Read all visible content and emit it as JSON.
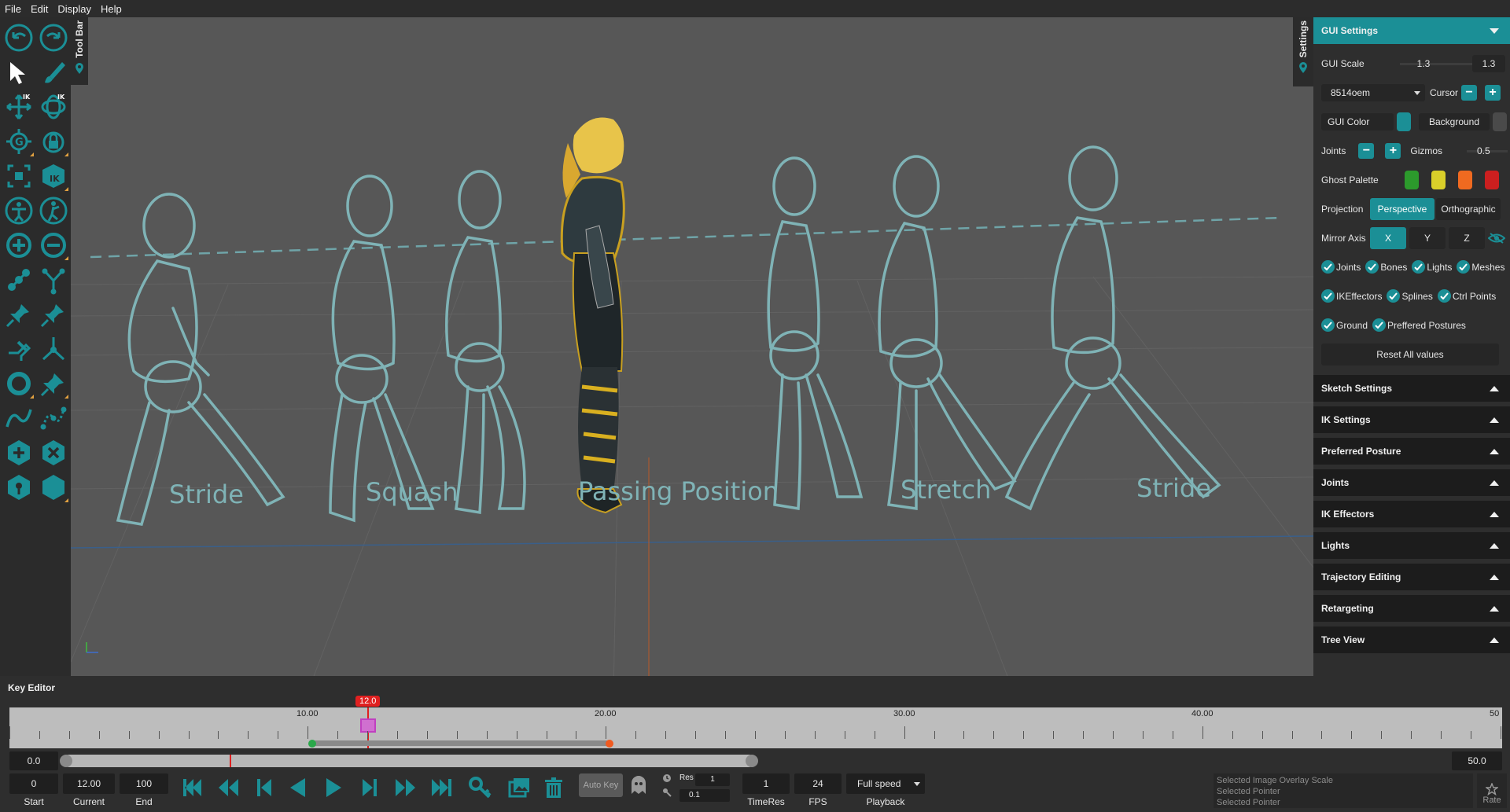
{
  "menubar": {
    "items": [
      "File",
      "Edit",
      "Display",
      "Help"
    ]
  },
  "toolbar": {
    "title": "Tool Bar",
    "tools": [
      {
        "name": "undo-icon"
      },
      {
        "name": "redo-icon"
      },
      {
        "name": "select-arrow-icon"
      },
      {
        "name": "brush-icon"
      },
      {
        "name": "ik-move-icon",
        "badge": "IK"
      },
      {
        "name": "ik-rotate-icon",
        "badge": "IK"
      },
      {
        "name": "global-icon",
        "badge": "G"
      },
      {
        "name": "lock-icon"
      },
      {
        "name": "frame-icon"
      },
      {
        "name": "ik-cube-icon",
        "badge": "IK"
      },
      {
        "name": "body-icon"
      },
      {
        "name": "pose-icon"
      },
      {
        "name": "add-joint-icon"
      },
      {
        "name": "remove-joint-icon"
      },
      {
        "name": "joint-chain-icon"
      },
      {
        "name": "fork-icon"
      },
      {
        "name": "pin-icon"
      },
      {
        "name": "pin-add-icon"
      },
      {
        "name": "pin-down-icon"
      },
      {
        "name": "branch-icon"
      },
      {
        "name": "ring-icon"
      },
      {
        "name": "pin-tilt-icon"
      },
      {
        "name": "spline-icon"
      },
      {
        "name": "spline-points-icon"
      },
      {
        "name": "hex-add-icon"
      },
      {
        "name": "hex-remove-icon"
      },
      {
        "name": "shield-pin-icon"
      },
      {
        "name": "hexagon-icon"
      }
    ]
  },
  "viewport": {
    "labels": [
      "Stride",
      "Squash",
      "Passing Position",
      "Stretch",
      "Stride"
    ]
  },
  "settings_tab": {
    "title": "Settings"
  },
  "gui": {
    "header": "GUI Settings",
    "scale_label": "GUI Scale",
    "scale_value": "1.3",
    "scale_value2": "1.3",
    "profile": "8514oem",
    "cursor_label": "Cursor",
    "gui_color_label": "GUI Color",
    "background_label": "Background",
    "joints_label": "Joints",
    "gizmos_label": "Gizmos",
    "gizmos_value": "0.5",
    "ghost_palette_label": "Ghost Palette",
    "ghost_colors": [
      "#2c9a2c",
      "#d9cf2a",
      "#f06a20",
      "#cc1f1f"
    ],
    "gui_color": "#1b8f96",
    "background_color": "#4a4a4a",
    "projection_label": "Projection",
    "projection_options": [
      "Perspective",
      "Orthographic"
    ],
    "mirror_label": "Mirror Axis",
    "mirror_options": [
      "X",
      "Y",
      "Z"
    ],
    "visibility": [
      "Joints",
      "Bones",
      "Lights",
      "Meshes"
    ],
    "visibility2": [
      "IKEffectors",
      "Splines",
      "Ctrl Points"
    ],
    "visibility3": [
      "Ground",
      "Preffered Postures"
    ],
    "reset_label": "Reset All values"
  },
  "sections": [
    "Sketch Settings",
    "IK Settings",
    "Preferred Posture",
    "Joints",
    "IK Effectors",
    "Lights",
    "Trajectory Editing",
    "Retargeting",
    "Tree View"
  ],
  "key_editor": {
    "title": "Key Editor",
    "current_marker": "12.0",
    "tick_labels": [
      "10.00",
      "20.00",
      "30.00",
      "40.00",
      "50"
    ],
    "scroll_start": "0.0",
    "scroll_end": "50.0",
    "start_value": "0",
    "start_label": "Start",
    "current_value": "12.00",
    "current_label": "Current",
    "end_value": "100",
    "end_label": "End",
    "autokey_label": "Auto Key",
    "res_label": "Res",
    "res_value": "1",
    "res_sub": "0.1",
    "timeres_value": "1",
    "timeres_label": "TimeRes",
    "fps_value": "24",
    "fps_label": "FPS",
    "playback_value": "Full speed",
    "playback_label": "Playback",
    "selection_info": [
      "Selected Image Overlay Scale",
      "Selected Pointer",
      "Selected Pointer"
    ],
    "rate_label": "Rate"
  }
}
